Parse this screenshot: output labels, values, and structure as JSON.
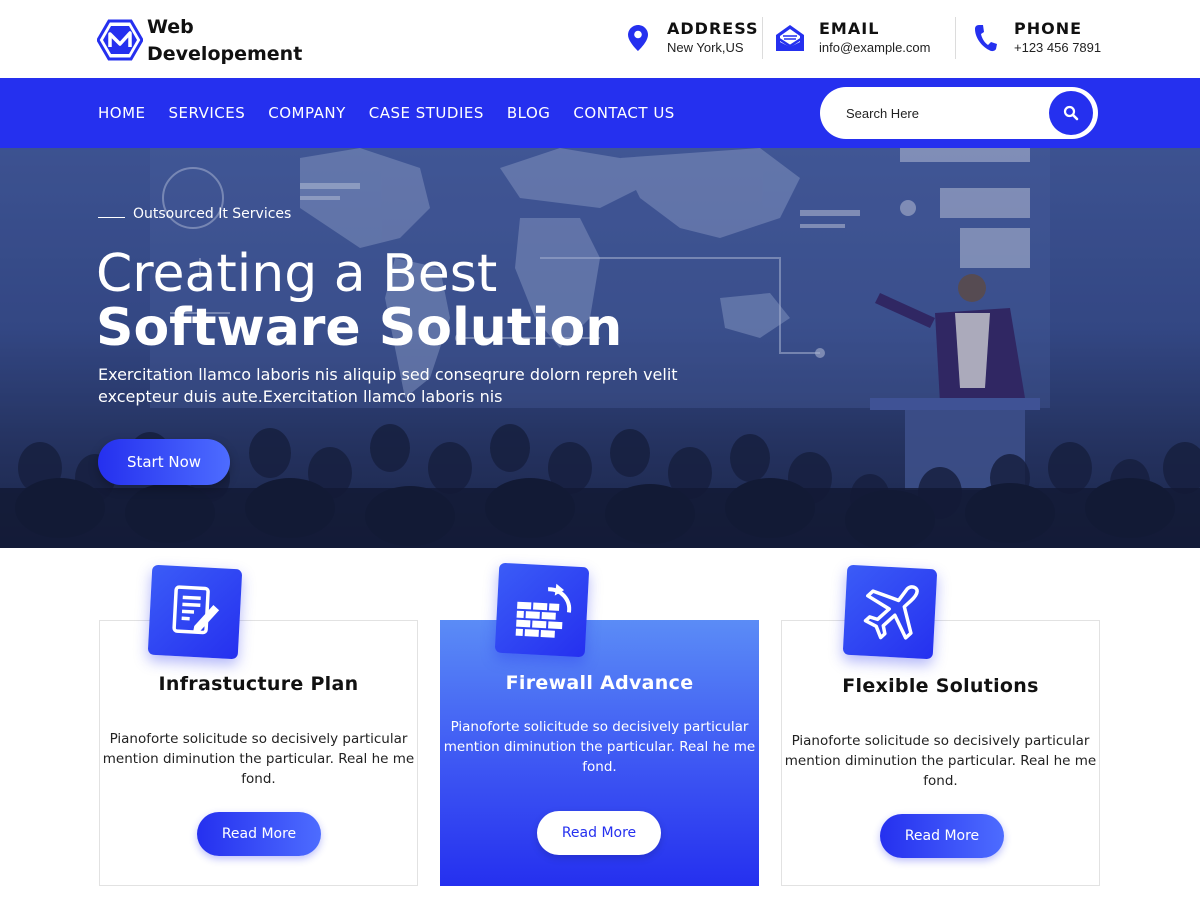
{
  "brand": {
    "line1": "Web",
    "line2": "Developement",
    "logo_icon": "hexagon-logo-icon"
  },
  "contacts": [
    {
      "label": "ADDRESS",
      "value": "New York,US",
      "icon": "map-pin-icon"
    },
    {
      "label": "EMAIL",
      "value": "info@example.com",
      "icon": "envelope-icon"
    },
    {
      "label": "PHONE",
      "value": "+123 456 7891",
      "icon": "phone-icon"
    }
  ],
  "nav": {
    "items": [
      "HOME",
      "SERVICES",
      "COMPANY",
      "CASE STUDIES",
      "BLOG",
      "CONTACT US"
    ],
    "search_placeholder": "Search Here",
    "search_icon": "search-icon"
  },
  "hero": {
    "tagline": "Outsourced It Services",
    "title_line1": "Creating a Best",
    "title_line2": "Software Solution",
    "description": "Exercitation llamco laboris nis aliquip sed conseqrure dolorn repreh velit excepteur duis aute.Exercitation llamco laboris nis",
    "button": "Start Now"
  },
  "cards": [
    {
      "icon": "document-edit-icon",
      "title": "Infrastucture Plan",
      "text": "Pianoforte solicitude so decisively particular mention diminution the particular. Real he me fond.",
      "button": "Read More"
    },
    {
      "icon": "firewall-icon",
      "title": "Firewall Advance",
      "text": "Pianoforte solicitude so decisively particular mention diminution the particular. Real he me fond.",
      "button": "Read More"
    },
    {
      "icon": "airplane-icon",
      "title": "Flexible Solutions",
      "text": "Pianoforte solicitude so decisively particular mention diminution the particular. Real he me fond.",
      "button": "Read More"
    }
  ],
  "colors": {
    "primary": "#2530ef",
    "header_bg": "#ffffff",
    "text_dark": "#111111"
  }
}
